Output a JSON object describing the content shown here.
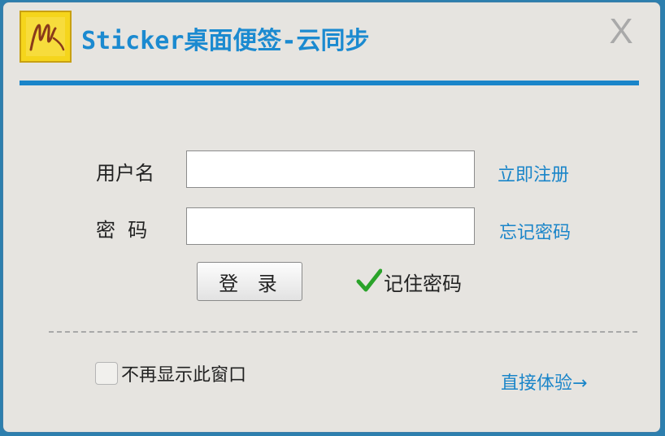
{
  "window": {
    "title": "Sticker桌面便签-云同步",
    "close_label": "X"
  },
  "form": {
    "username_label": "用户名",
    "username_value": "",
    "password_label": "密  码",
    "password_value": "",
    "register_link": "立即注册",
    "forgot_link": "忘记密码",
    "login_button": "登 录",
    "remember_label": "记住密码",
    "remember_checked": true
  },
  "footer": {
    "dont_show_label": "不再显示此窗口",
    "dont_show_checked": false,
    "direct_link": "直接体验→"
  },
  "colors": {
    "accent": "#1a85c9",
    "logo": "#f5d51c",
    "check": "#2aa32a",
    "background": "#e6e4e0"
  }
}
